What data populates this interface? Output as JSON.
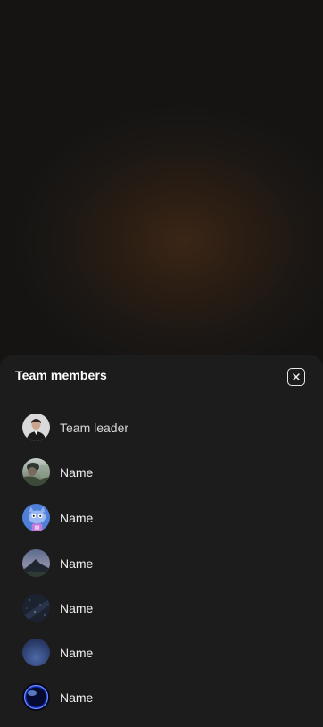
{
  "sheet": {
    "title": "Team members"
  },
  "members": [
    {
      "name": "Team leader",
      "avatar": "person-photo-avatar"
    },
    {
      "name": "Name",
      "avatar": "cyclist-photo-avatar"
    },
    {
      "name": "Name",
      "avatar": "cartoon-cat-avatar"
    },
    {
      "name": "Name",
      "avatar": "mountain-avatar"
    },
    {
      "name": "Name",
      "avatar": "night-sky-avatar"
    },
    {
      "name": "Name",
      "avatar": "blue-gradient-avatar"
    },
    {
      "name": "Name",
      "avatar": "blue-orb-avatar"
    }
  ],
  "colors": {
    "sheet_bg": "#1c1c1d",
    "backdrop_glow": "#3b2616",
    "text_primary": "#ffffff"
  },
  "icons": {
    "close": "close-icon"
  }
}
